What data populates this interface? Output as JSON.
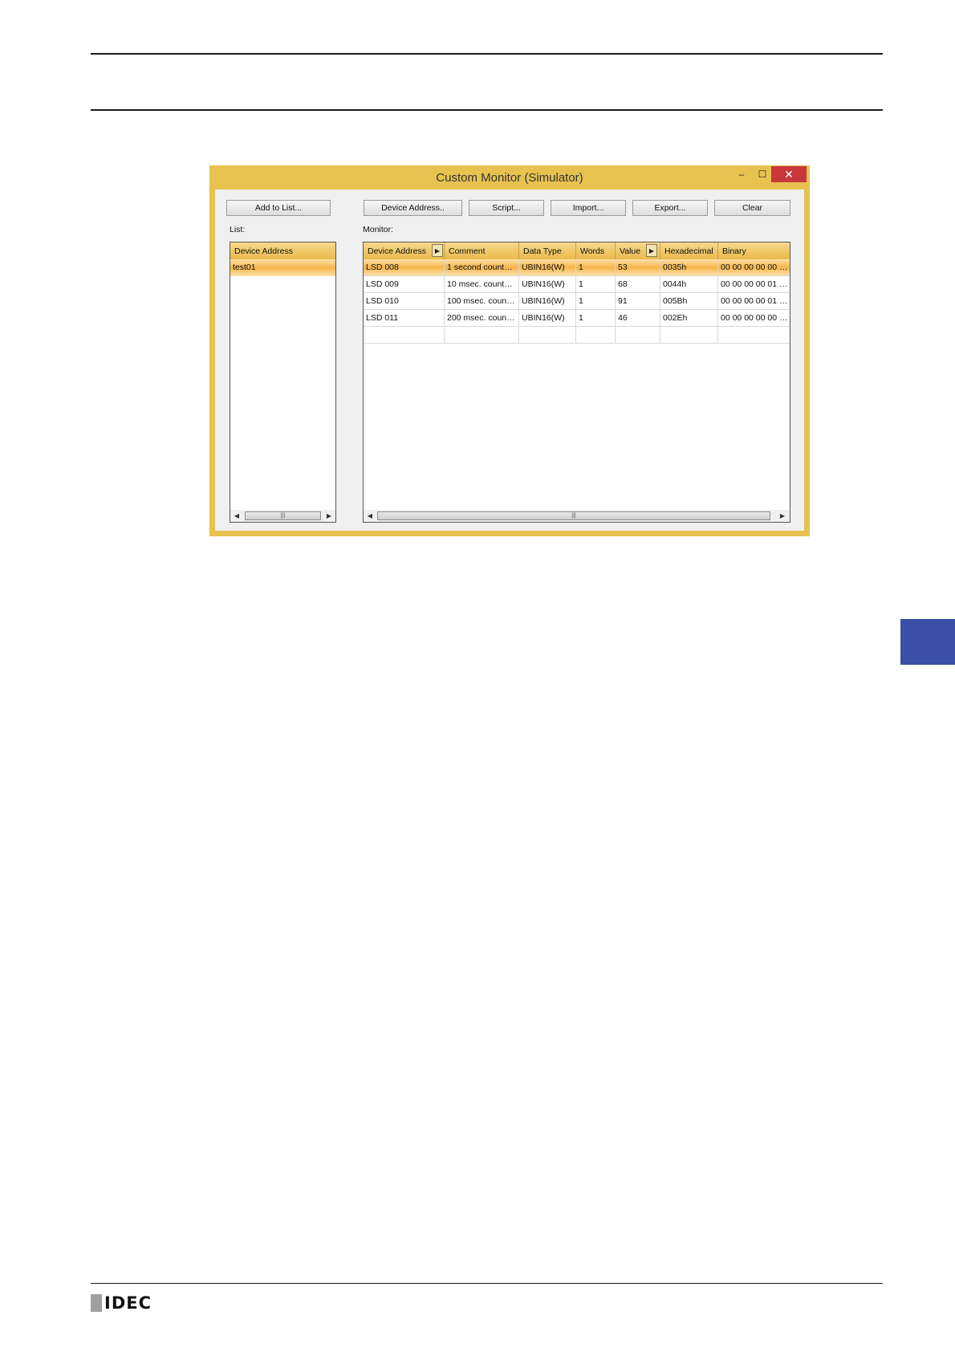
{
  "window": {
    "title": "Custom Monitor (Simulator)",
    "minimize_glyph": "–",
    "maximize_glyph": "☐",
    "close_glyph": "✕"
  },
  "buttons": {
    "add_to_list": "Add to List...",
    "device_address": "Device Address..",
    "script": "Script...",
    "import": "Import...",
    "export": "Export...",
    "clear": "Clear"
  },
  "labels": {
    "list": "List:",
    "monitor": "Monitor:"
  },
  "list": {
    "header": "Device Address",
    "items": [
      "test01"
    ]
  },
  "monitor": {
    "columns": [
      "Device Address",
      "Comment",
      "Data Type",
      "Words",
      "Value",
      "Hexadecimal",
      "Binary"
    ],
    "rows": [
      [
        "LSD 008",
        "1 second count…",
        "UBIN16(W)",
        "1",
        "53",
        "0035h",
        "00 00 00 00 00 …"
      ],
      [
        "LSD 009",
        "10 msec. count…",
        "UBIN16(W)",
        "1",
        "68",
        "0044h",
        "00 00 00 00 01 …"
      ],
      [
        "LSD 010",
        "100 msec. coun…",
        "UBIN16(W)",
        "1",
        "91",
        "005Bh",
        "00 00 00 00 01 …"
      ],
      [
        "LSD 011",
        "200 msec. coun…",
        "UBIN16(W)",
        "1",
        "46",
        "002Eh",
        "00 00 00 00 00 …"
      ]
    ],
    "selected_row": 0
  },
  "scroll": {
    "left": "◀",
    "right": "▶",
    "grip": "|||"
  },
  "footer": {
    "logo_text": "IDEC"
  },
  "colors": {
    "window_frame": "#e8c24f",
    "side_tab": "#3a4fa5",
    "close_button": "#c8373a"
  }
}
